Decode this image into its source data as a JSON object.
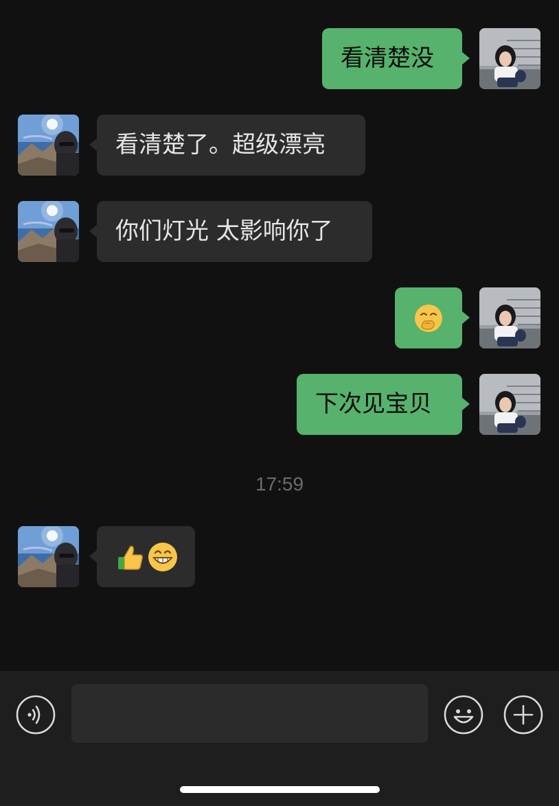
{
  "colors": {
    "background": "#111111",
    "outgoing_bubble": "#56B26C",
    "incoming_bubble": "#2C2C2C",
    "input_bar": "#1E1E1E",
    "timestamp_text": "#6B6B6B"
  },
  "messages": [
    {
      "direction": "outgoing",
      "text": "看清楚没"
    },
    {
      "direction": "incoming",
      "text": "看清楚了。超级漂亮"
    },
    {
      "direction": "incoming",
      "text": "你们灯光 太影响你了"
    },
    {
      "direction": "outgoing",
      "emoji": [
        "face-with-hand-over-mouth"
      ]
    },
    {
      "direction": "outgoing",
      "text": "下次见宝贝"
    },
    {
      "direction": "incoming",
      "emoji": [
        "thumbs-up",
        "grinning-face"
      ]
    }
  ],
  "timestamp": "17:59",
  "input_bar": {
    "voice_icon": "voice-wave-icon",
    "placeholder": "",
    "emoji_icon": "smiley-icon",
    "more_icon": "plus-circle-icon"
  }
}
